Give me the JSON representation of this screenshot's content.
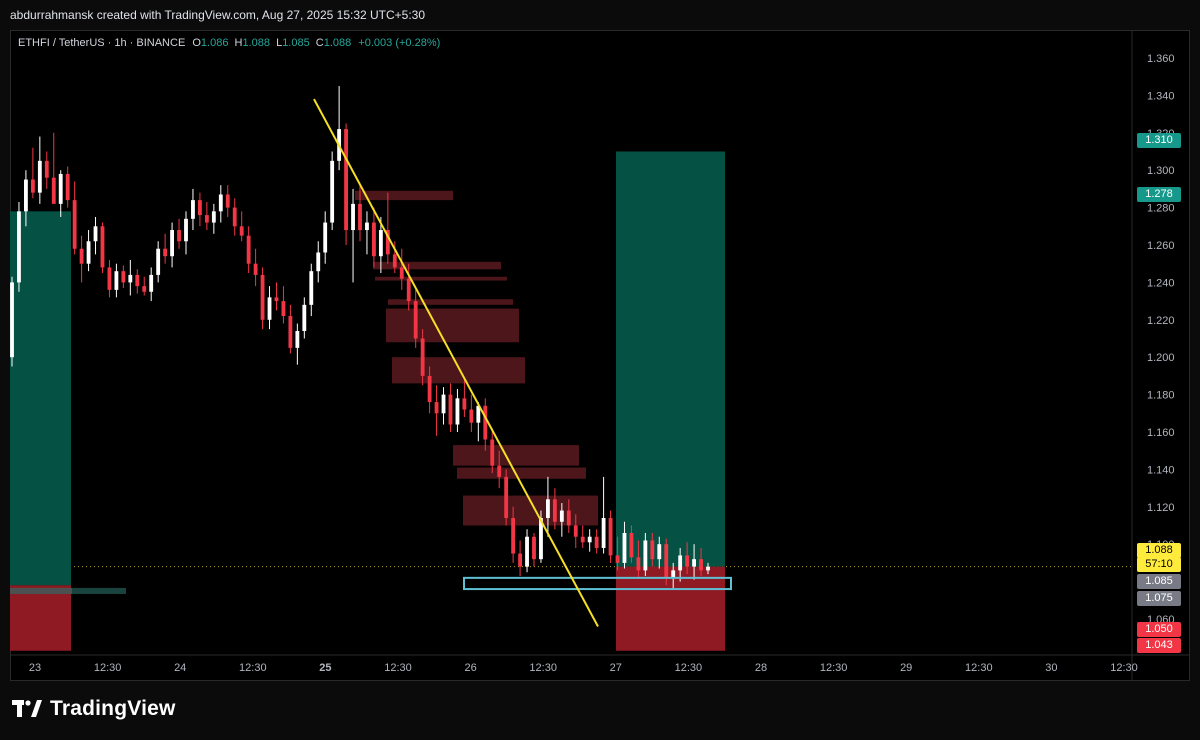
{
  "header": {
    "credit": "abdurrahmansk created with TradingView.com, Aug 27, 2025 15:32 UTC+5:30"
  },
  "legend": {
    "symbol": "ETHFI / TetherUS · 1h · BINANCE",
    "open_key": "O",
    "open": "1.086",
    "high_key": "H",
    "high": "1.088",
    "low_key": "L",
    "low": "1.085",
    "close_key": "C",
    "close": "1.088",
    "change": "+0.003 (+0.28%)"
  },
  "colors": {
    "up": "#ffffff",
    "down": "#f23645",
    "trendline": "#f5e025",
    "tp_zone": "#055245",
    "sl_zone": "#8f1a24",
    "liquidity_box": "#5a1a1e",
    "support_box": "#5fbfd4",
    "last_price": "#ffeb3b",
    "tp_label": "#16998a",
    "sl_label": "#f23645",
    "neutral_label": "#787b86"
  },
  "price_labels": {
    "tp": "1.310",
    "entry_alt": "1.278",
    "last": "1.088",
    "countdown": "57:10",
    "low": "1.085",
    "support": "1.075",
    "sl": "1.050",
    "sl2": "1.043"
  },
  "footer": {
    "logo_text": "TradingView"
  },
  "chart_data": {
    "type": "candlestick",
    "title": "ETHFI / TetherUS · 1h · BINANCE",
    "ylim": [
      1.045,
      1.37
    ],
    "y_ticks": [
      "1.360",
      "1.340",
      "1.320",
      "1.300",
      "1.280",
      "1.260",
      "1.240",
      "1.220",
      "1.200",
      "1.180",
      "1.160",
      "1.140",
      "1.120",
      "1.100",
      "1.080",
      "1.060"
    ],
    "x_tick_labels": [
      "23",
      "12:30",
      "24",
      "12:30",
      "25",
      "12:30",
      "26",
      "12:30",
      "27",
      "12:30",
      "28",
      "12:30",
      "29",
      "12:30",
      "30",
      "12:30"
    ],
    "candles": [
      [
        1.2,
        1.243,
        1.195,
        1.24
      ],
      [
        1.24,
        1.283,
        1.235,
        1.278
      ],
      [
        1.278,
        1.3,
        1.27,
        1.295
      ],
      [
        1.295,
        1.312,
        1.285,
        1.288
      ],
      [
        1.288,
        1.318,
        1.282,
        1.305
      ],
      [
        1.305,
        1.31,
        1.29,
        1.296
      ],
      [
        1.296,
        1.32,
        1.288,
        1.282
      ],
      [
        1.282,
        1.3,
        1.275,
        1.298
      ],
      [
        1.298,
        1.302,
        1.28,
        1.284
      ],
      [
        1.284,
        1.294,
        1.255,
        1.258
      ],
      [
        1.258,
        1.265,
        1.24,
        1.25
      ],
      [
        1.25,
        1.268,
        1.246,
        1.262
      ],
      [
        1.262,
        1.275,
        1.255,
        1.27
      ],
      [
        1.27,
        1.272,
        1.245,
        1.248
      ],
      [
        1.248,
        1.252,
        1.232,
        1.236
      ],
      [
        1.236,
        1.25,
        1.232,
        1.246
      ],
      [
        1.246,
        1.249,
        1.237,
        1.24
      ],
      [
        1.24,
        1.252,
        1.233,
        1.244
      ],
      [
        1.244,
        1.247,
        1.234,
        1.238
      ],
      [
        1.238,
        1.243,
        1.233,
        1.235
      ],
      [
        1.235,
        1.248,
        1.23,
        1.244
      ],
      [
        1.244,
        1.262,
        1.24,
        1.258
      ],
      [
        1.258,
        1.266,
        1.25,
        1.254
      ],
      [
        1.254,
        1.272,
        1.248,
        1.268
      ],
      [
        1.268,
        1.274,
        1.258,
        1.262
      ],
      [
        1.262,
        1.278,
        1.255,
        1.274
      ],
      [
        1.274,
        1.29,
        1.268,
        1.284
      ],
      [
        1.284,
        1.288,
        1.27,
        1.276
      ],
      [
        1.276,
        1.283,
        1.268,
        1.272
      ],
      [
        1.272,
        1.282,
        1.266,
        1.278
      ],
      [
        1.278,
        1.292,
        1.272,
        1.287
      ],
      [
        1.287,
        1.292,
        1.275,
        1.28
      ],
      [
        1.28,
        1.285,
        1.265,
        1.27
      ],
      [
        1.27,
        1.278,
        1.262,
        1.265
      ],
      [
        1.265,
        1.27,
        1.245,
        1.25
      ],
      [
        1.25,
        1.258,
        1.238,
        1.244
      ],
      [
        1.244,
        1.248,
        1.215,
        1.22
      ],
      [
        1.22,
        1.238,
        1.215,
        1.232
      ],
      [
        1.232,
        1.24,
        1.225,
        1.23
      ],
      [
        1.23,
        1.238,
        1.218,
        1.222
      ],
      [
        1.222,
        1.228,
        1.202,
        1.205
      ],
      [
        1.205,
        1.218,
        1.196,
        1.214
      ],
      [
        1.214,
        1.232,
        1.21,
        1.228
      ],
      [
        1.228,
        1.25,
        1.222,
        1.246
      ],
      [
        1.246,
        1.262,
        1.24,
        1.256
      ],
      [
        1.256,
        1.278,
        1.25,
        1.272
      ],
      [
        1.272,
        1.31,
        1.268,
        1.305
      ],
      [
        1.305,
        1.345,
        1.3,
        1.322
      ],
      [
        1.322,
        1.325,
        1.26,
        1.268
      ],
      [
        1.268,
        1.29,
        1.24,
        1.282
      ],
      [
        1.282,
        1.292,
        1.262,
        1.268
      ],
      [
        1.268,
        1.278,
        1.255,
        1.272
      ],
      [
        1.272,
        1.28,
        1.248,
        1.254
      ],
      [
        1.254,
        1.275,
        1.245,
        1.268
      ],
      [
        1.268,
        1.288,
        1.25,
        1.255
      ],
      [
        1.255,
        1.262,
        1.245,
        1.248
      ],
      [
        1.248,
        1.258,
        1.236,
        1.242
      ],
      [
        1.242,
        1.25,
        1.225,
        1.23
      ],
      [
        1.23,
        1.236,
        1.205,
        1.21
      ],
      [
        1.21,
        1.215,
        1.185,
        1.19
      ],
      [
        1.19,
        1.195,
        1.17,
        1.176
      ],
      [
        1.176,
        1.185,
        1.158,
        1.17
      ],
      [
        1.17,
        1.184,
        1.164,
        1.18
      ],
      [
        1.18,
        1.186,
        1.16,
        1.164
      ],
      [
        1.164,
        1.183,
        1.16,
        1.178
      ],
      [
        1.178,
        1.188,
        1.168,
        1.172
      ],
      [
        1.172,
        1.18,
        1.16,
        1.165
      ],
      [
        1.165,
        1.176,
        1.155,
        1.174
      ],
      [
        1.174,
        1.178,
        1.15,
        1.156
      ],
      [
        1.156,
        1.162,
        1.138,
        1.142
      ],
      [
        1.142,
        1.15,
        1.13,
        1.136
      ],
      [
        1.136,
        1.14,
        1.11,
        1.114
      ],
      [
        1.114,
        1.12,
        1.09,
        1.095
      ],
      [
        1.095,
        1.102,
        1.083,
        1.088
      ],
      [
        1.088,
        1.108,
        1.085,
        1.104
      ],
      [
        1.104,
        1.106,
        1.088,
        1.092
      ],
      [
        1.092,
        1.118,
        1.09,
        1.114
      ],
      [
        1.114,
        1.136,
        1.104,
        1.124
      ],
      [
        1.124,
        1.13,
        1.108,
        1.112
      ],
      [
        1.112,
        1.122,
        1.104,
        1.118
      ],
      [
        1.118,
        1.124,
        1.106,
        1.11
      ],
      [
        1.11,
        1.116,
        1.098,
        1.104
      ],
      [
        1.104,
        1.11,
        1.098,
        1.101
      ],
      [
        1.101,
        1.108,
        1.096,
        1.104
      ],
      [
        1.104,
        1.108,
        1.095,
        1.098
      ],
      [
        1.098,
        1.136,
        1.095,
        1.114
      ],
      [
        1.114,
        1.118,
        1.09,
        1.094
      ],
      [
        1.094,
        1.104,
        1.086,
        1.09
      ],
      [
        1.09,
        1.112,
        1.087,
        1.106
      ],
      [
        1.106,
        1.11,
        1.09,
        1.093
      ],
      [
        1.093,
        1.102,
        1.082,
        1.086
      ],
      [
        1.086,
        1.106,
        1.083,
        1.102
      ],
      [
        1.102,
        1.106,
        1.088,
        1.092
      ],
      [
        1.092,
        1.104,
        1.087,
        1.1
      ],
      [
        1.1,
        1.103,
        1.078,
        1.082
      ],
      [
        1.082,
        1.09,
        1.076,
        1.086
      ],
      [
        1.086,
        1.098,
        1.08,
        1.094
      ],
      [
        1.094,
        1.101,
        1.084,
        1.088
      ],
      [
        1.088,
        1.1,
        1.081,
        1.092
      ],
      [
        1.092,
        1.098,
        1.083,
        1.086
      ],
      [
        1.086,
        1.09,
        1.084,
        1.088
      ]
    ],
    "trendline": {
      "from": [
        1.338
      ],
      "to": [
        1.056
      ]
    },
    "annotations": [
      {
        "kind": "long_position",
        "take_profit": 1.31,
        "entry": 1.088,
        "stop": 1.05
      },
      {
        "kind": "long_position_left",
        "take_profit": 1.278,
        "entry": 1.078,
        "stop": 1.05
      },
      {
        "kind": "support_box",
        "top": 1.082,
        "bottom": 1.076
      },
      {
        "kind": "sl_line",
        "value": 1.075
      }
    ],
    "liquidity_boxes": [
      {
        "top": 1.289,
        "bottom": 1.284
      },
      {
        "top": 1.251,
        "bottom": 1.247
      },
      {
        "top": 1.243,
        "bottom": 1.241
      },
      {
        "top": 1.231,
        "bottom": 1.228
      },
      {
        "top": 1.226,
        "bottom": 1.208
      },
      {
        "top": 1.2,
        "bottom": 1.186
      },
      {
        "top": 1.153,
        "bottom": 1.142
      },
      {
        "top": 1.141,
        "bottom": 1.135
      },
      {
        "top": 1.126,
        "bottom": 1.11
      }
    ]
  }
}
